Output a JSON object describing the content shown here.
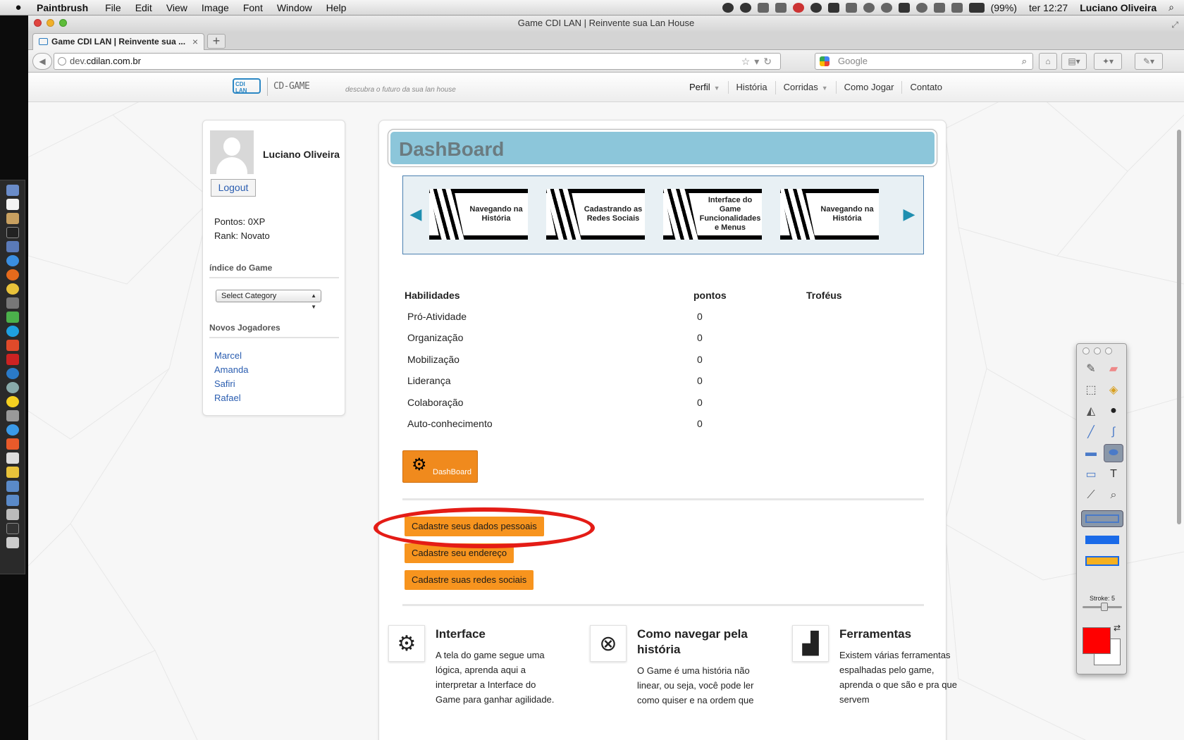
{
  "menubar": {
    "app_name": "Paintbrush",
    "menus": [
      "File",
      "Edit",
      "View",
      "Image",
      "Font",
      "Window",
      "Help"
    ],
    "battery": "(99%)",
    "clock": "ter 12:27",
    "user": "Luciano Oliveira"
  },
  "window": {
    "title": "Game CDI LAN | Reinvente sua Lan House",
    "tab_title": "Game CDI LAN | Reinvente sua ...",
    "tab_close": "×",
    "new_tab": "+"
  },
  "navbar": {
    "back": "◀",
    "url_prefix": "dev.",
    "url_domain": "cdilan.com.br",
    "search_placeholder": "Google",
    "url_icons": "☆▾↻"
  },
  "site": {
    "logo_line1": "CDI",
    "logo_line2": "LAN",
    "logo_name": "CD-GAME",
    "tagline": "descubra o futuro da sua lan house",
    "nav": {
      "perfil": "Perfil",
      "historia": "História",
      "corridas": "Corridas",
      "como_jogar": "Como Jogar",
      "contato": "Contato"
    }
  },
  "sidebar": {
    "user_name": "Luciano Oliveira",
    "logout": "Logout",
    "points": "Pontos: 0XP",
    "rank": "Rank: Novato",
    "index_heading": "índice do Game",
    "select_value": "Select Category",
    "new_players_heading": "Novos Jogadores",
    "players": [
      "Marcel",
      "Amanda",
      "Safiri",
      "Rafael"
    ]
  },
  "main": {
    "title": "DashBoard",
    "carousel": [
      "Navegando na História",
      "Cadastrando as Redes Sociais",
      "Interface do Game Funcionalidades e Menus",
      "Navegando na História"
    ],
    "skills_header": {
      "habilidades": "Habilidades",
      "pontos": "pontos",
      "trofeus": "Troféus"
    },
    "skills": [
      {
        "name": "Pró-Atividade",
        "points": "0"
      },
      {
        "name": "Organização",
        "points": "0"
      },
      {
        "name": "Mobilização",
        "points": "0"
      },
      {
        "name": "Liderança",
        "points": "0"
      },
      {
        "name": "Colaboração",
        "points": "0"
      },
      {
        "name": "Auto-conhecimento",
        "points": "0"
      }
    ],
    "dashboard_button": "DashBoard",
    "actions": {
      "dados": "Cadastre seus dados pessoais",
      "endereco": "Cadastre seu endereço",
      "redes": "Cadastre suas redes sociais"
    },
    "features": [
      {
        "title": "Interface",
        "text": "A tela do game segue uma lógica, aprenda aqui a interpretar a Interface do Game para ganhar agilidade."
      },
      {
        "title": "Como navegar pela história",
        "text": "O Game é uma história não linear, ou seja, você pode ler como quiser e na ordem que"
      },
      {
        "title": "Ferramentas",
        "text": "Existem várias ferramentas espalhadas pelo game, aprenda o que são e pra que servem"
      }
    ]
  },
  "tools": {
    "stroke_label": "Stroke: 5",
    "foreground_color": "#ff0000",
    "background_color": "#ffffff",
    "annotation_color": "#e41c16"
  }
}
